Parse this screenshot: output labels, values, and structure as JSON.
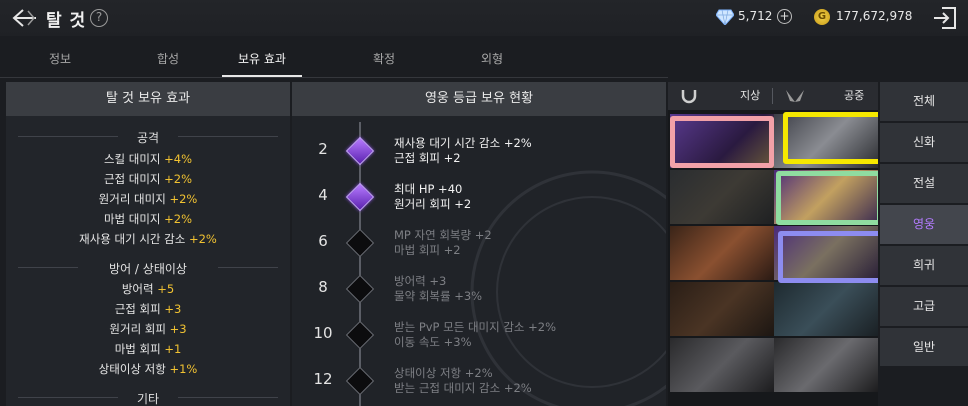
{
  "header": {
    "title": "탈 것",
    "help_label": "?",
    "gems": "5,712",
    "plus_label": "+",
    "gold_symbol": "G",
    "gold": "177,672,978"
  },
  "tabs": [
    {
      "label": "정보"
    },
    {
      "label": "합성"
    },
    {
      "label": "보유 효과"
    },
    {
      "label": "확정"
    },
    {
      "label": "외형"
    }
  ],
  "active_tab": "보유 효과",
  "left_panel": {
    "title": "탈 것 보유 효과",
    "sections": [
      {
        "title": "공격",
        "stats": [
          {
            "name": "스킬 대미지",
            "value": "+4%"
          },
          {
            "name": "근접 대미지",
            "value": "+2%"
          },
          {
            "name": "원거리 대미지",
            "value": "+2%"
          },
          {
            "name": "마법 대미지",
            "value": "+2%"
          },
          {
            "name": "재사용 대기 시간 감소",
            "value": "+2%"
          }
        ]
      },
      {
        "title": "방어 / 상태이상",
        "stats": [
          {
            "name": "방어력",
            "value": "+5"
          },
          {
            "name": "근접 회피",
            "value": "+3"
          },
          {
            "name": "원거리 회피",
            "value": "+3"
          },
          {
            "name": "마법 회피",
            "value": "+1"
          },
          {
            "name": "상태이상 저항",
            "value": "+1%"
          }
        ]
      },
      {
        "title": "기타",
        "stats": []
      }
    ]
  },
  "mid_panel": {
    "title": "영웅 등급 보유 현황",
    "tiers": [
      {
        "level": "2",
        "achieved": true,
        "effects": [
          "재사용 대기 시간 감소 +2%",
          "근접 회피 +2"
        ]
      },
      {
        "level": "4",
        "achieved": true,
        "effects": [
          "최대 HP +40",
          "원거리 회피 +2"
        ]
      },
      {
        "level": "6",
        "achieved": false,
        "effects": [
          "MP 자연 회복량 +2",
          "마법 회피 +2"
        ]
      },
      {
        "level": "8",
        "achieved": false,
        "effects": [
          "방어력 +3",
          "물약 회복률 +3%"
        ]
      },
      {
        "level": "10",
        "achieved": false,
        "effects": [
          "받는 PvP 모든 대미지 감소 +2%",
          "이동 속도 +3%"
        ]
      },
      {
        "level": "12",
        "achieved": false,
        "effects": [
          "상태이상 저항 +2%",
          "받는 근접 대미지 감소 +2%"
        ]
      }
    ]
  },
  "grid": {
    "ground_label": "지상",
    "air_label": "공중"
  },
  "grade_menu": [
    {
      "label": "전체"
    },
    {
      "label": "신화"
    },
    {
      "label": "전설"
    },
    {
      "label": "영웅"
    },
    {
      "label": "희귀"
    },
    {
      "label": "고급"
    },
    {
      "label": "일반"
    }
  ],
  "active_grade": "영웅",
  "colors": {
    "accent_gold": "#f1c232",
    "active_grade": "#b37bff",
    "highlight_pink": "#f2a1a8",
    "highlight_yellow": "#f5e800",
    "highlight_green": "#8fdca0",
    "highlight_blue": "#8d8cf0"
  }
}
